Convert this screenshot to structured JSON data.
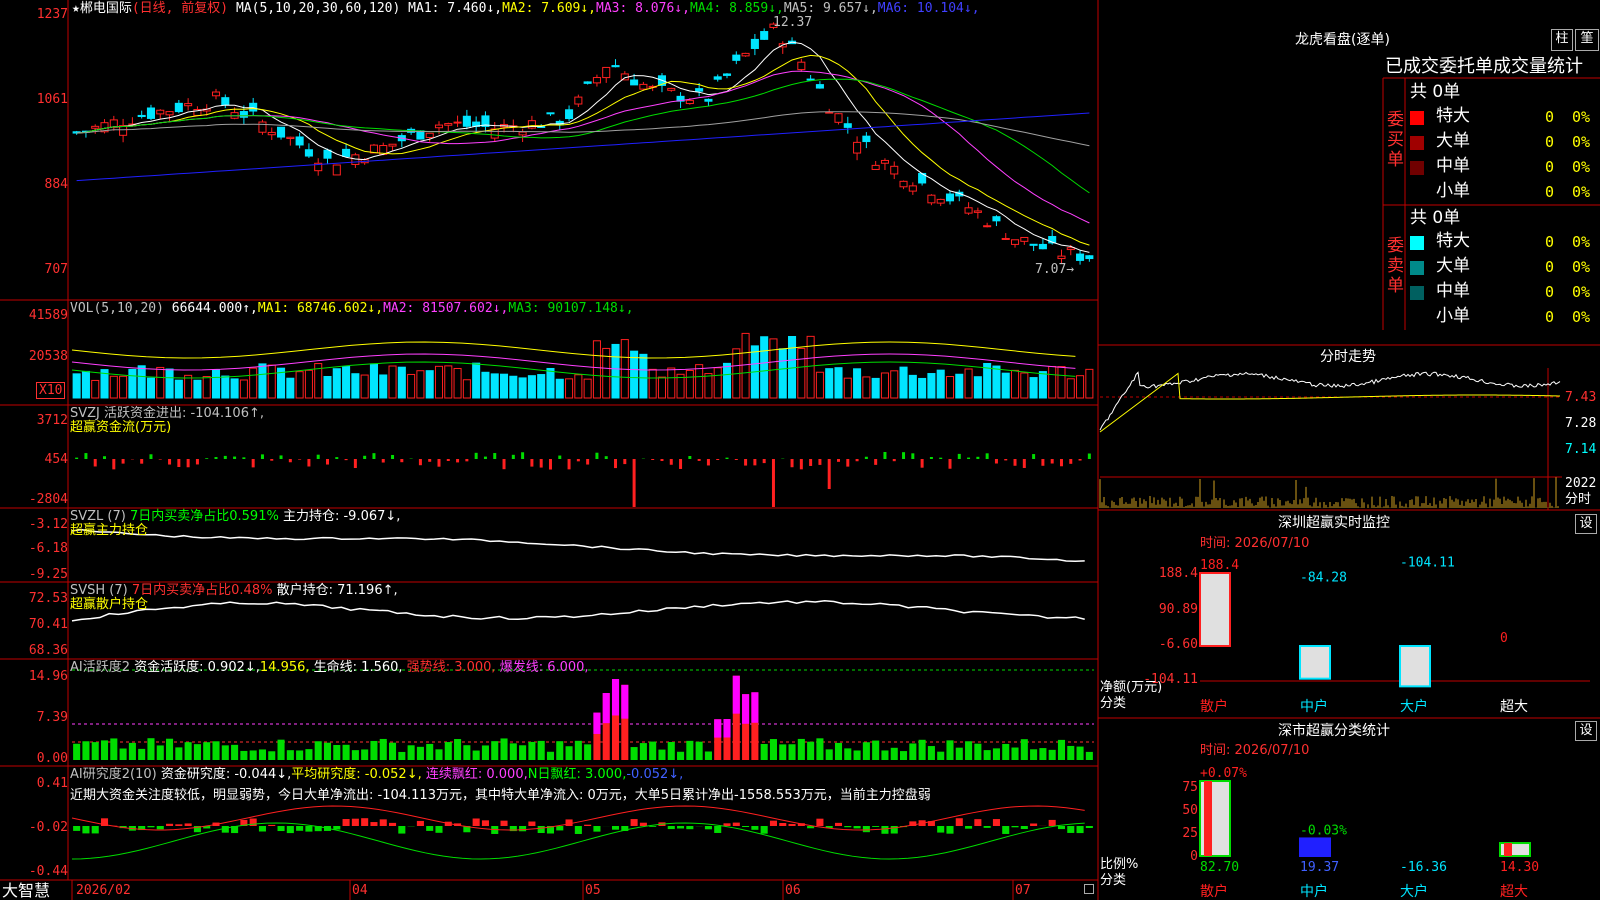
{
  "colors": {
    "up": "#ff2020",
    "down": "#00e5ff",
    "border": "#c00000",
    "ma1": "#ffffff",
    "ma2": "#ffff00",
    "ma3": "#ff40ff",
    "ma4": "#00dd00",
    "ma5": "#8080ff",
    "ma6": "#0000ff",
    "green": "#00ff00",
    "magenta": "#ff00ff"
  },
  "kline": {
    "title": "★郴电国际",
    "mode": "(日线, 前复权)",
    "ma_prefix": "MA(5,10,20,30,60,120)",
    "ma": [
      "MA1: 7.460↓,",
      "MA2: 7.609↓,",
      "MA3: 8.076↓,",
      "MA4: 8.859↓,",
      "MA5: 9.657↓,",
      "MA6: 10.104↓,"
    ],
    "axis": [
      "1237",
      "1061",
      "884",
      "707"
    ],
    "high_label": "12.37",
    "low_label": "7.07→"
  },
  "vol": {
    "label": "VOL(5,10,20)",
    "value": "66644.000↑,",
    "ma": [
      "MA1: 68746.602↓,",
      "MA2: 81507.602↓,",
      "MA3: 90107.148↓,"
    ],
    "axis": [
      "41589",
      "20538"
    ],
    "unit": "X10"
  },
  "svzj": {
    "line1": "SVZJ  活跃资金进出: -104.106↑,",
    "line2": "超赢资金流(万元)",
    "axis": [
      "3712",
      "454",
      "-2804"
    ]
  },
  "svzl": {
    "line1_a": "SVZL (7)",
    "line1_b": "7日内买卖净占比0.591%",
    "line1_c": "主力持仓: -9.067↓,",
    "line2": "超赢主力持仓",
    "axis": [
      "-3.12",
      "-6.18",
      "-9.25"
    ]
  },
  "svsh": {
    "line1_a": "SVSH (7)",
    "line1_b": "7日内买卖净占比0.48%",
    "line1_c": "散户持仓: 71.196↑,",
    "line2": "超赢散户持仓",
    "axis": [
      "72.53",
      "70.41",
      "68.36"
    ]
  },
  "ai1": {
    "a": "AI活跃度2",
    "b": "资金活跃度: 0.902↓,",
    "c": "14.956,",
    "d": "生命线: 1.560,",
    "e": "强势线: 3.000,",
    "f": "爆发线: 6.000,",
    "axis": [
      "14.96",
      "7.39",
      "0.00"
    ]
  },
  "ai2": {
    "a": "AI研究度2(10)",
    "b": "资金研究度: -0.044↓,",
    "c": "平均研究度: -0.052↓,",
    "d": "连续飘红: 0.000,",
    "e": "N日飘红: 3.000,",
    "f": "-0.052↓,",
    "desc": "近期大资金关注度较低，明显弱势，今日大单净流出: -104.113万元，其中特大单净流入: 0万元，大单5日累计净出-1558.553万元，当前主力控盘弱",
    "axis": [
      "0.41",
      "-0.02",
      "-0.44"
    ]
  },
  "dates": [
    "2026/02",
    "04",
    "05",
    "06",
    "07"
  ],
  "logo": "大智慧",
  "dragon": {
    "title": "龙虎看盘(逐单)",
    "btn_zhu": "柱",
    "btn_ge": "筀",
    "header": "已成交委托单成交量统计",
    "buy_label": "委买单",
    "sell_label": "委卖单",
    "buy_total": "共 0单",
    "sell_total": "共 0单",
    "buy_rows": [
      {
        "name": "特大",
        "v": "0",
        "p": "0%"
      },
      {
        "name": "大单",
        "v": "0",
        "p": "0%"
      },
      {
        "name": "中单",
        "v": "0",
        "p": "0%"
      },
      {
        "name": "小单",
        "v": "0",
        "p": "0%"
      }
    ],
    "sell_rows": [
      {
        "name": "特大",
        "v": "0",
        "p": "0%"
      },
      {
        "name": "大单",
        "v": "0",
        "p": "0%"
      },
      {
        "name": "中单",
        "v": "0",
        "p": "0%"
      },
      {
        "name": "小单",
        "v": "0",
        "p": "0%"
      }
    ]
  },
  "intraday": {
    "title": "分时走势",
    "axis": [
      "7.43",
      "7.28",
      "7.14"
    ],
    "vol_label": "2022",
    "vol_unit": "分时"
  },
  "monitor": {
    "title": "深圳超赢实时监控",
    "settings": "设",
    "time": "时间: 2026/07/10",
    "axis": [
      "188.4",
      "90.89",
      "-6.60",
      "-104.11"
    ],
    "ylabel": "净额(万元)",
    "xlabel": "分类",
    "categories": [
      "散户",
      "中户",
      "大户",
      "超大"
    ],
    "values": [
      188.4,
      -84.28,
      -104.11,
      0
    ],
    "value_labels": [
      "188.4",
      "-84.28",
      "-104.11",
      "0"
    ]
  },
  "classify": {
    "title": "深市超赢分类统计",
    "settings": "设",
    "time": "时间: 2026/07/10",
    "axis": [
      "75",
      "50",
      "25",
      "0"
    ],
    "ylabel": "比例%",
    "xlabel": "分类",
    "categories": [
      "散户",
      "中户",
      "大户",
      "超大"
    ],
    "top_labels": [
      "+0.07%",
      "-0.03%",
      "",
      ""
    ],
    "values": [
      82.7,
      19.37,
      -16.36,
      14.3
    ],
    "value_labels": [
      "82.70",
      "19.37",
      "-16.36",
      "14.30"
    ]
  }
}
